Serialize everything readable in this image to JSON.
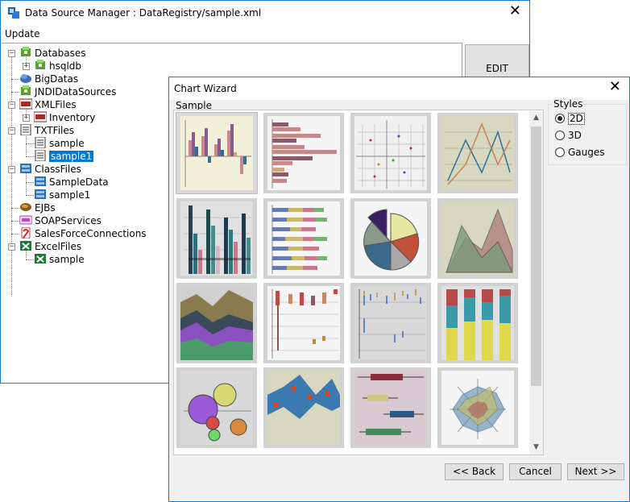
{
  "back_window": {
    "title": "Data Source Manager : DataRegistry/sample.xml",
    "close_glyph": "✕",
    "menu": [
      "Update"
    ],
    "edit_label": "EDIT",
    "tree": [
      {
        "label": "Databases",
        "icon": "database-icon",
        "toggle": "−"
      },
      {
        "label": "hsqldb",
        "icon": "database-icon",
        "toggle": "+"
      },
      {
        "label": "BigDatas",
        "icon": "cloud-icon"
      },
      {
        "label": "JNDIDataSources",
        "icon": "database-icon"
      },
      {
        "label": "XMLFiles",
        "icon": "xml-icon",
        "toggle": "−"
      },
      {
        "label": "Inventory",
        "icon": "xml-icon",
        "toggle": "+"
      },
      {
        "label": "TXTFiles",
        "icon": "text-file-icon",
        "toggle": "−"
      },
      {
        "label": "sample",
        "icon": "text-file-icon"
      },
      {
        "label": "sample1",
        "icon": "text-file-icon",
        "selected": true
      },
      {
        "label": "ClassFiles",
        "icon": "class-icon",
        "toggle": "−"
      },
      {
        "label": "SampleData",
        "icon": "class-icon"
      },
      {
        "label": "sample1",
        "icon": "class-icon"
      },
      {
        "label": "EJBs",
        "icon": "bean-icon"
      },
      {
        "label": "SOAPServices",
        "icon": "soap-icon"
      },
      {
        "label": "SalesForceConnections",
        "icon": "salesforce-icon"
      },
      {
        "label": "ExcelFiles",
        "icon": "excel-icon",
        "toggle": "−"
      },
      {
        "label": "sample",
        "icon": "excel-icon"
      }
    ]
  },
  "wizard": {
    "title": "Chart Wizard",
    "close_glyph": "✕",
    "sample_label": "Sample",
    "styles_label": "Styles",
    "styles": [
      {
        "label": "2D",
        "checked": true
      },
      {
        "label": "3D",
        "checked": false
      },
      {
        "label": "Gauges",
        "checked": false
      }
    ],
    "buttons": {
      "back": "<< Back",
      "cancel": "Cancel",
      "next": "Next >>"
    },
    "scroll_up": "▲",
    "scroll_down": "▼",
    "thumbnails": [
      "column-chart",
      "bar-chart",
      "scatter-chart",
      "line-chart",
      "stacked-column-chart",
      "stacked-bar-chart",
      "pie-chart",
      "area-chart",
      "stacked-area-chart",
      "hi-lo-chart",
      "hlco-chart",
      "percent-stacked-column-chart",
      "bubble-chart",
      "range-chart",
      "box-plot-chart",
      "radar-chart"
    ]
  }
}
